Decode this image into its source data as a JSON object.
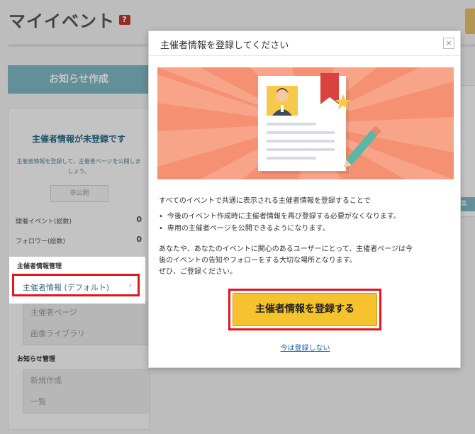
{
  "page": {
    "title": "マイイベント",
    "help_badge": "?",
    "notice_button": "お知らせ作成",
    "right_button_fragment": "集"
  },
  "sidebar": {
    "status_heading": "主催者情報が未登録です",
    "status_desc": "主催者情報を登録して、主催者ページを公開しましょう。",
    "private_button": "非公開",
    "stats": [
      {
        "label": "開催イベント(総数)",
        "value": "0"
      },
      {
        "label": "フォロワー(総数)",
        "value": "0"
      }
    ],
    "organizer_section": "主催者情報管理",
    "organizer_items": [
      {
        "label": "主催者情報 (デフォルト)",
        "chevron": "›"
      },
      {
        "label": "主催者ページ"
      },
      {
        "label": "画像ライブラリ"
      }
    ],
    "notice_section": "お知らせ管理",
    "notice_items": [
      {
        "label": "新規作成"
      },
      {
        "label": "一覧"
      }
    ]
  },
  "modal": {
    "title": "主催者情報を登録してください",
    "close": "×",
    "intro": "すべてのイベントで共通に表示される主催者情報を登録することで",
    "bullets": [
      "今後のイベント作成時に主催者情報を再び登録する必要がなくなります。",
      "専用の主催者ページを公開できるようになります。"
    ],
    "paragraph_lines": [
      "あなたや、あなたのイベントに関心のあるユーザーにとって、主催者ページは今",
      "後のイベントの告知やフォローをする大切な場所となります。",
      "ぜひ、ご登録ください。"
    ],
    "cta": "主催者情報を登録する",
    "skip": "今は登録しない"
  },
  "colors": {
    "accent_red": "#e6141e",
    "cta_yellow": "#f6c22e",
    "teal_button": "#7fb8c4",
    "illustration_bg": "#f59172",
    "link_blue": "#1b5fa8"
  }
}
